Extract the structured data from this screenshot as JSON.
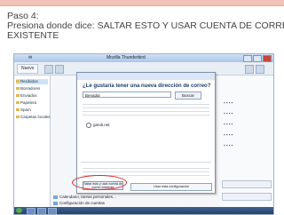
{
  "slide": {
    "title_line1": "Paso 4:",
    "title_line2": "Presiona donde dice: SALTAR ESTO Y USAR CUENTA DE CORREO",
    "title_line3": "EXISTENTE"
  },
  "screenshot": {
    "window_title": "Mozilla Thunderbird",
    "toolbar": {
      "new_button": "Nuevo"
    },
    "sidebar": {
      "items": [
        "Recibidos",
        "Borradores",
        "Enviados",
        "Papelera",
        "Spam",
        "Carpetas locales"
      ]
    },
    "dialog": {
      "question": "¿Le gustaría tener una nueva dirección de correo?",
      "search_input_value": "Benadid",
      "search_button": "Buscar",
      "provider_option": "gandi.net",
      "skip_button": "Saltar esto y usar cuenta de correo existente",
      "alt_button": "Usar esta configuración"
    },
    "bottom_items": [
      "Calendario, tareas personales...",
      "Configuración de cuentas"
    ],
    "colors": {
      "highlight_oval": "#d62d2d",
      "title_text": "#444444",
      "top_band": "#f2c3b6"
    }
  }
}
